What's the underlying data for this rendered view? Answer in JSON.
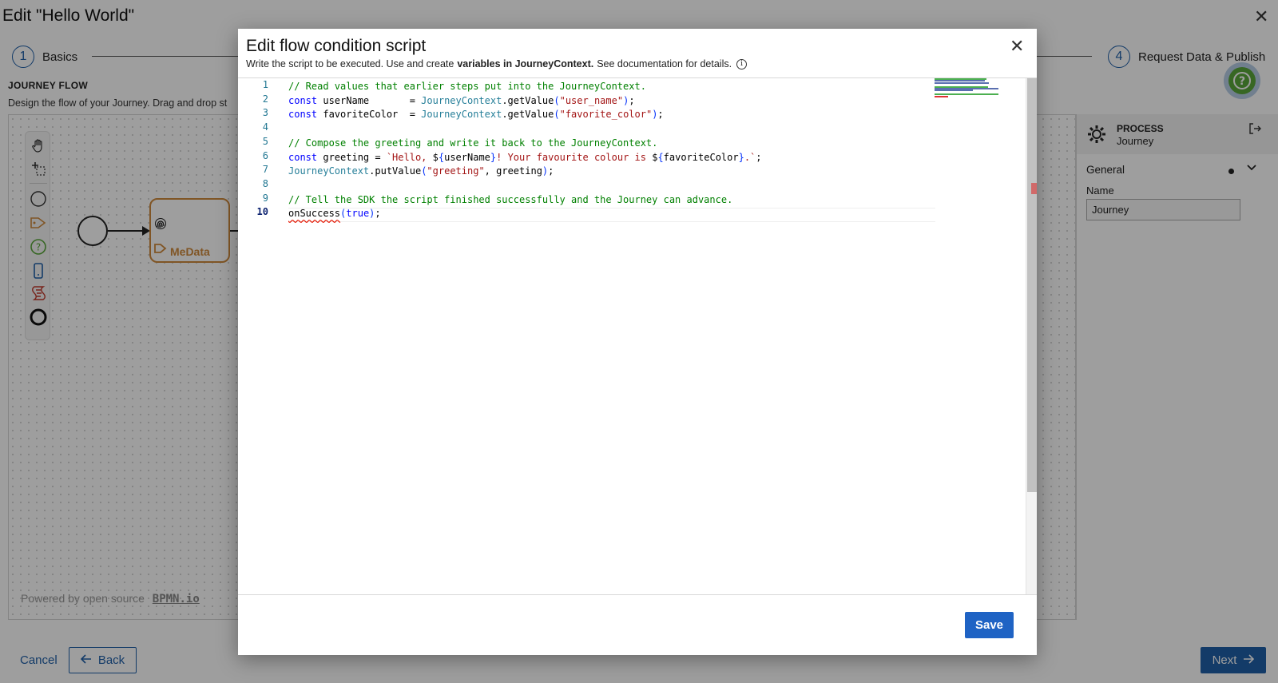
{
  "page": {
    "title": "Edit \"Hello World\"",
    "close_glyph": "✕"
  },
  "stepper": [
    {
      "number": "1",
      "label": "Basics"
    },
    {
      "number": "4",
      "label": "Request Data & Publish"
    }
  ],
  "flow": {
    "section_title": "JOURNEY FLOW",
    "description": "Design the flow of your Journey. Drag and drop st",
    "task_label": "MeData",
    "powered_by": "Powered by open source",
    "powered_brand": "BPMN.io"
  },
  "properties": {
    "kind": "PROCESS",
    "name": "Journey",
    "group": "General",
    "field_label": "Name",
    "field_value": "Journey"
  },
  "footer": {
    "cancel": "Cancel",
    "back": "Back",
    "next": "Next"
  },
  "modal": {
    "title": "Edit flow condition script",
    "subtitle_pre": "Write the script to be executed. Use and create",
    "subtitle_bold": "variables in JourneyContext.",
    "subtitle_post": " See documentation for details.",
    "close_glyph": "✕",
    "save_label": "Save",
    "active_line": 10,
    "code_lines": [
      "// Read values that earlier steps put into the JourneyContext.",
      "const userName       = JourneyContext.getValue(\"user_name\");",
      "const favoriteColor  = JourneyContext.getValue(\"favorite_color\");",
      "",
      "// Compose the greeting and write it back to the JourneyContext.",
      "const greeting = `Hello, ${userName}! Your favourite colour is ${favoriteColor}.`;",
      "JourneyContext.putValue(\"greeting\", greeting);",
      "",
      "// Tell the SDK the script finished successfully and the Journey can advance.",
      "onSuccess(true);"
    ]
  },
  "icons": {
    "help": "help-circle-icon",
    "gear": "gear-icon",
    "exit": "exit-panel-icon",
    "info": "info-icon"
  },
  "colors": {
    "primary": "#1f5fa8",
    "task_accent": "#cf8a3c",
    "help_green": "#5aa73a"
  }
}
